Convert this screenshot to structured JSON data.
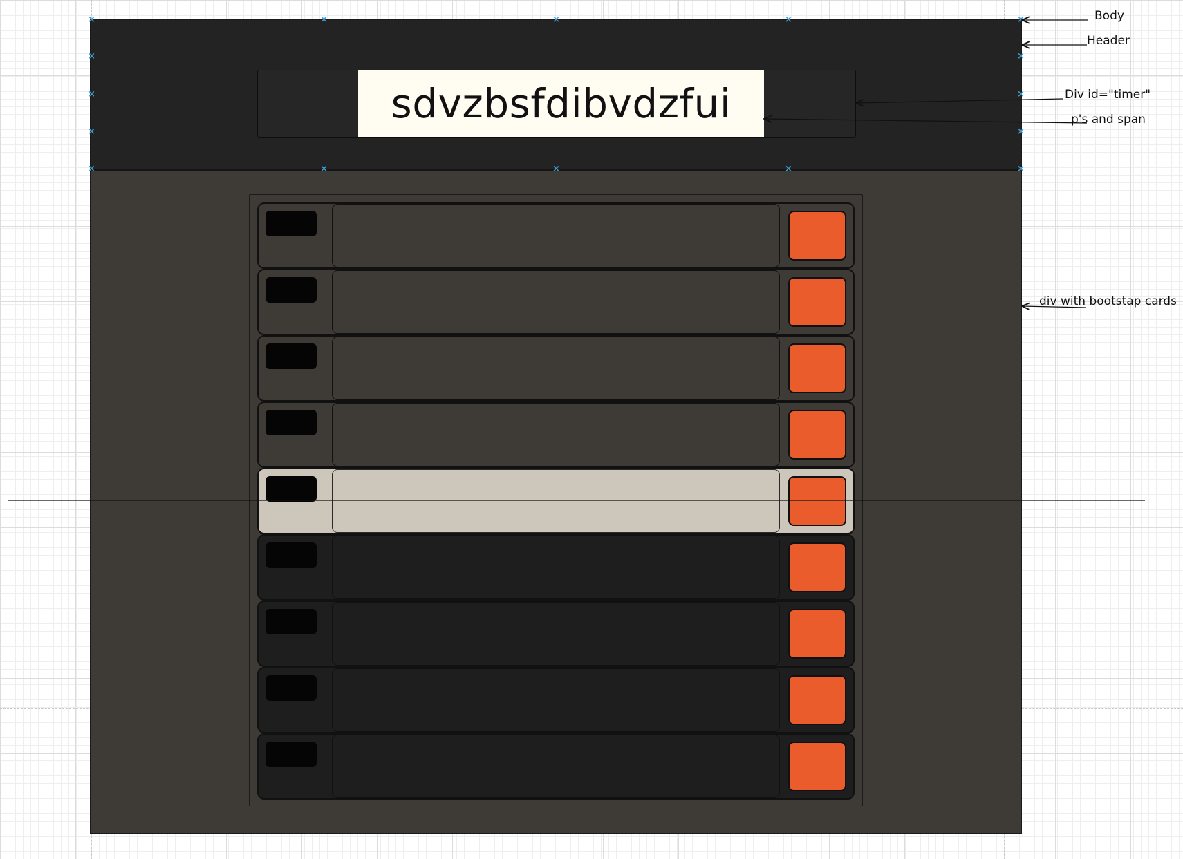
{
  "timer": {
    "text": "sdvzbsfdibvdzfui"
  },
  "annotations": {
    "body": "Body",
    "header": "Header",
    "timer_div": "Div id=\"timer\"",
    "ps_and_span": "p's and span",
    "cards_div": "div with bootstap cards"
  },
  "cards": [
    {
      "state": "dim"
    },
    {
      "state": "dim"
    },
    {
      "state": "dim"
    },
    {
      "state": "dim"
    },
    {
      "state": "active"
    },
    {
      "state": "dark"
    },
    {
      "state": "dark"
    },
    {
      "state": "dark"
    },
    {
      "state": "dark"
    }
  ],
  "colors": {
    "body_background": "#3e3a35",
    "header_background": "#232323",
    "timer_text_background": "#fffcf1",
    "card_dim": "#3e3a35",
    "card_active": "#cdc6bb",
    "card_dark": "#1e1e1e",
    "card_badge": "#050505",
    "card_button": "#ea5c2b",
    "handle": "#3d9fd6"
  }
}
